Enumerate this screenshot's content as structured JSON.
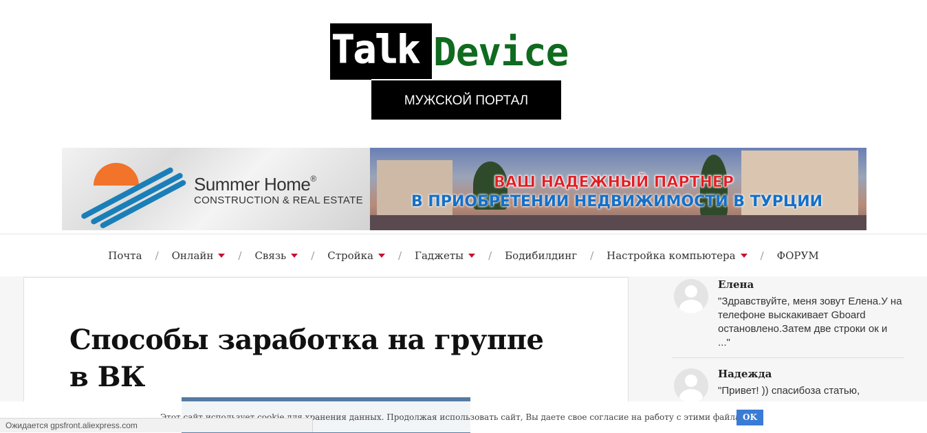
{
  "logo": {
    "part1": "Talk",
    "part2": "Device",
    "subtitle": "МУЖСКОЙ ПОРТАЛ"
  },
  "banner": {
    "brand": "Summer Home",
    "brand_reg": "®",
    "brand_sub": "CONSTRUCTION & REAL ESTATE",
    "promo_line1": "ВАШ НАДЕЖНЫЙ ПАРТНЕР",
    "promo_line2": "В ПРИОБРЕТЕНИИ НЕДВИЖИМОСТИ В ТУРЦИИ"
  },
  "nav": {
    "items": [
      {
        "label": "Почта",
        "dropdown": false
      },
      {
        "label": "Онлайн",
        "dropdown": true
      },
      {
        "label": "Связь",
        "dropdown": true
      },
      {
        "label": "Стройка",
        "dropdown": true
      },
      {
        "label": "Гаджеты",
        "dropdown": true
      },
      {
        "label": "Бодибилдинг",
        "dropdown": false
      },
      {
        "label": "Настройка компьютера",
        "dropdown": true
      },
      {
        "label": "ФОРУМ",
        "dropdown": false
      }
    ],
    "separator": "/",
    "accent_color": "#c8102e"
  },
  "article": {
    "title": "Способы заработка на группе в ВК"
  },
  "comments": [
    {
      "author": "Елена",
      "text": "\"Здравствуйте, меня зовут Елена.У на телефоне выскакивает Gboard остановлено.Затем две строки ок и ...\""
    },
    {
      "author": "Надежда",
      "text": "\"Привет! )) спасибоза статью,"
    }
  ],
  "cookie": {
    "text": "Этот сайт использует cookie для хранения данных. Продолжая использовать сайт, Вы даете свое согласие на работу с этими файлами.",
    "button": "OK"
  },
  "status_bar": "Ожидается gpsfront.aliexpress.com",
  "colors": {
    "logo_green": "#0f6b1f",
    "button_blue": "#3a7bd5",
    "promo_red": "#e11d24",
    "promo_blue": "#1570c8"
  }
}
